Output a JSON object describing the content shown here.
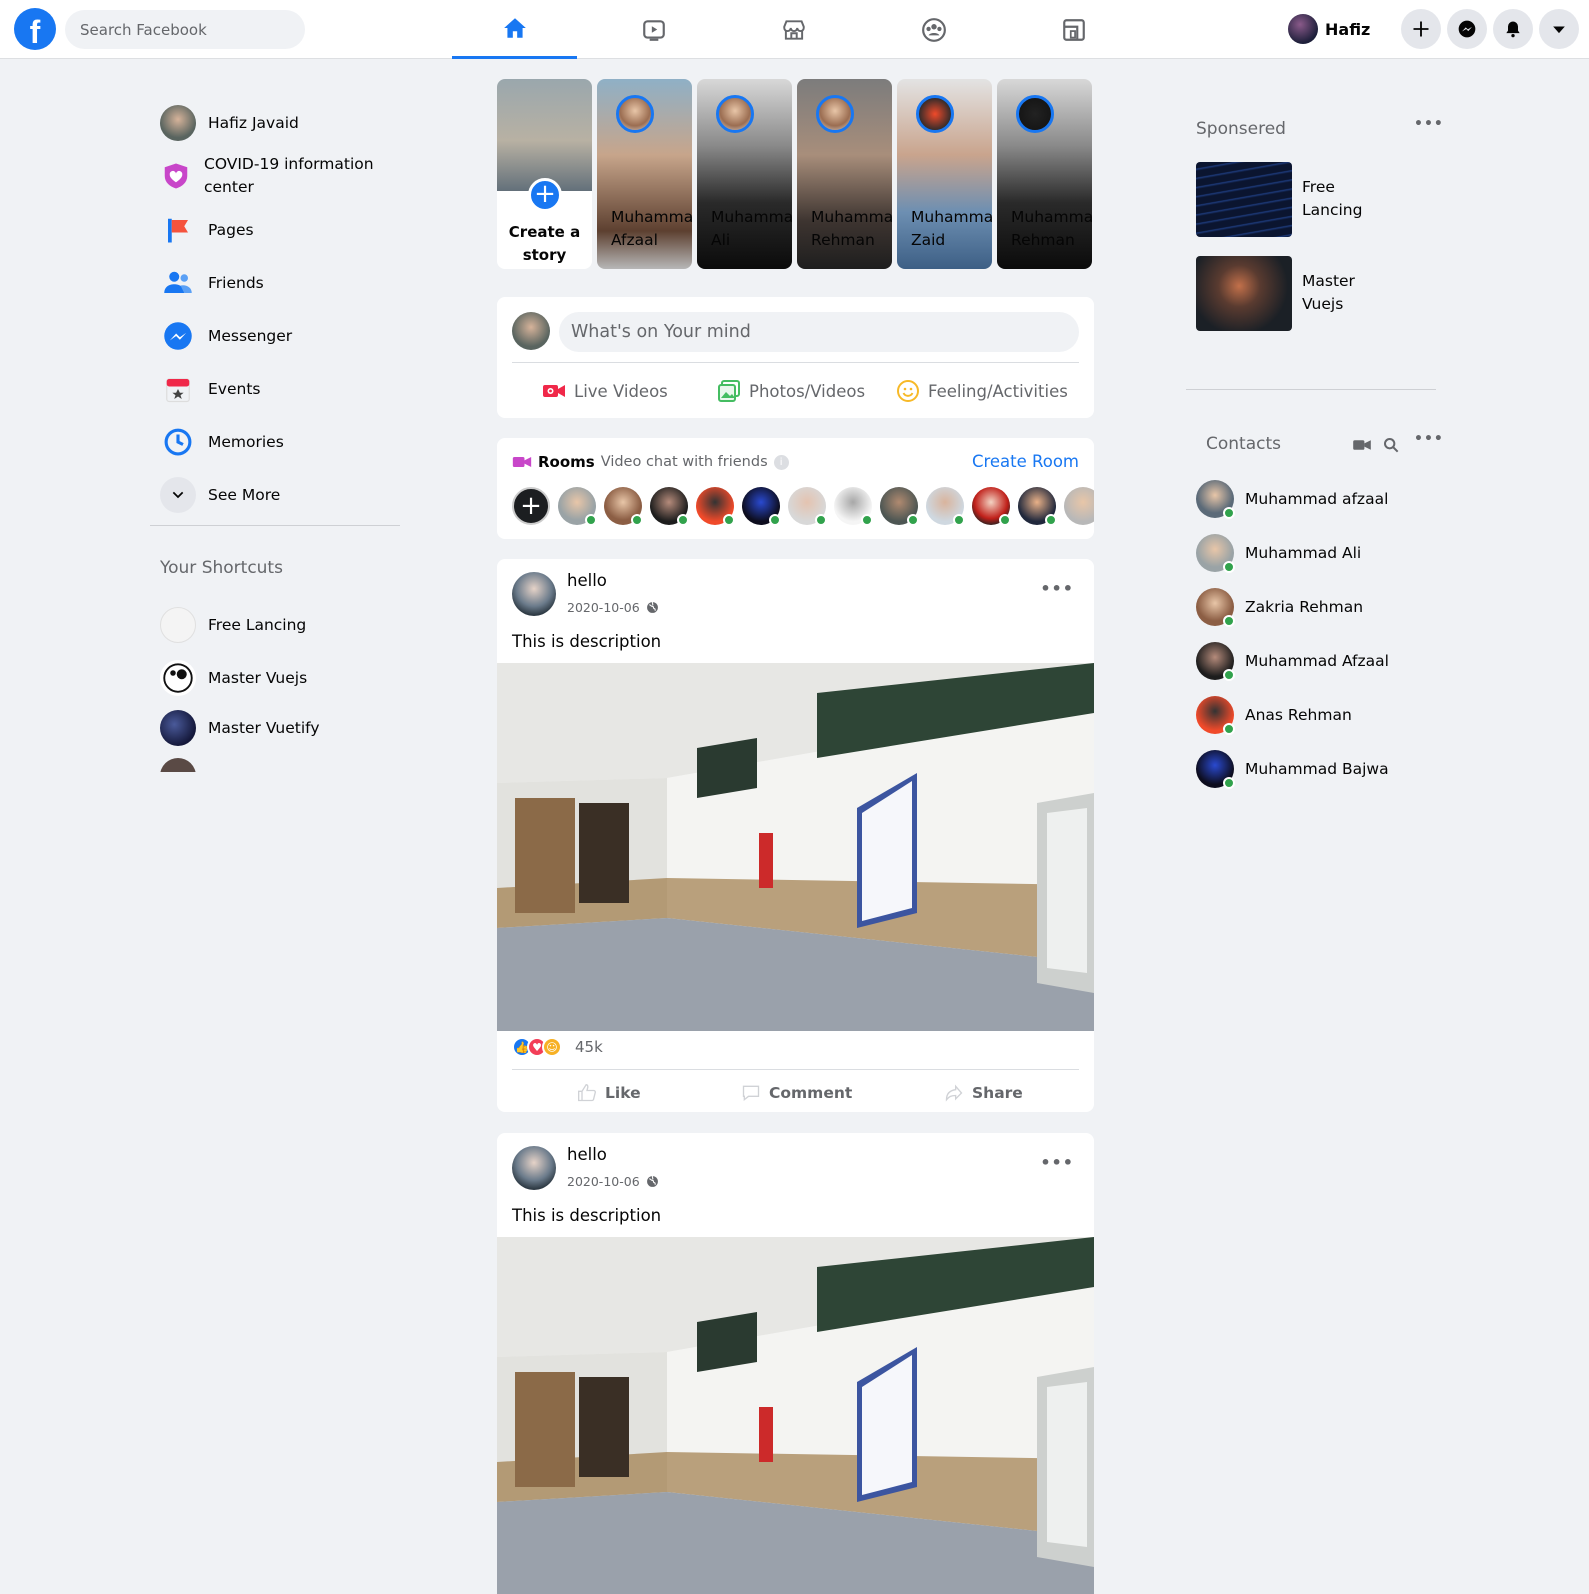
{
  "search": {
    "placeholder": "Search Facebook"
  },
  "logo": {
    "glyph": "f"
  },
  "header": {
    "user_name": "Hafiz",
    "tabs": [
      "home-icon",
      "watch-icon",
      "marketplace-icon",
      "groups-icon",
      "gaming-icon"
    ],
    "actions": [
      "plus-icon",
      "messenger-icon",
      "bell-icon",
      "caret-down-icon"
    ]
  },
  "left_nav": {
    "items": [
      {
        "label": "Hafiz Javaid",
        "icon": "avatar"
      },
      {
        "label": "COVID-19 information center",
        "icon": "shield-heart-icon"
      },
      {
        "label": "Pages",
        "icon": "flag-icon"
      },
      {
        "label": "Friends",
        "icon": "friends-icon"
      },
      {
        "label": "Messenger",
        "icon": "messenger-icon"
      },
      {
        "label": "Events",
        "icon": "calendar-icon"
      },
      {
        "label": "Memories",
        "icon": "clock-icon"
      },
      {
        "label": "See More",
        "icon": "chevron-down-icon"
      }
    ],
    "shortcuts_title": "Your Shortcuts",
    "shortcuts": [
      {
        "label": "Free Lancing"
      },
      {
        "label": "Master Vuejs"
      },
      {
        "label": "Master Vuetify"
      }
    ]
  },
  "stories": {
    "create_label": "Create a\nstory",
    "items": [
      {
        "name": "Muhammad\nAfzaal"
      },
      {
        "name": "Muhammad\nAli"
      },
      {
        "name": "Muhammad\nRehman"
      },
      {
        "name": "Muhammad\nZaid"
      },
      {
        "name": "Muhammad\nRehman"
      }
    ]
  },
  "composer": {
    "placeholder": "What's on Your mind",
    "buttons": [
      {
        "label": "Live Videos",
        "icon": "video-camera-icon",
        "color": "#f02849"
      },
      {
        "label": "Photos/Videos",
        "icon": "photo-icon",
        "color": "#45bd62"
      },
      {
        "label": "Feeling/Activities",
        "icon": "smiley-icon",
        "color": "#f7b928"
      }
    ]
  },
  "rooms": {
    "title": "Rooms",
    "subtitle": "Video chat with friends",
    "create_label": "Create Room"
  },
  "posts": [
    {
      "author": "hello",
      "date": "2020-10-06",
      "description": "This is description",
      "reaction_count": "45k"
    },
    {
      "author": "hello",
      "date": "2020-10-06",
      "description": "This is description",
      "reaction_count": ""
    }
  ],
  "post_actions": {
    "like": "Like",
    "comment": "Comment",
    "share": "Share"
  },
  "sponsored": {
    "title": "Sponsered",
    "items": [
      {
        "label": "Free\nLancing"
      },
      {
        "label": "Master\nVuejs"
      }
    ]
  },
  "contacts": {
    "title": "Contacts",
    "items": [
      {
        "name": "Muhammad afzaal"
      },
      {
        "name": "Muhammad Ali"
      },
      {
        "name": "Zakria Rehman"
      },
      {
        "name": "Muhammad Afzaal"
      },
      {
        "name": "Anas Rehman"
      },
      {
        "name": "Muhammad Bajwa"
      }
    ]
  },
  "colors": {
    "accent": "#1877f2",
    "online": "#31a24c",
    "background": "#f0f2f5"
  }
}
